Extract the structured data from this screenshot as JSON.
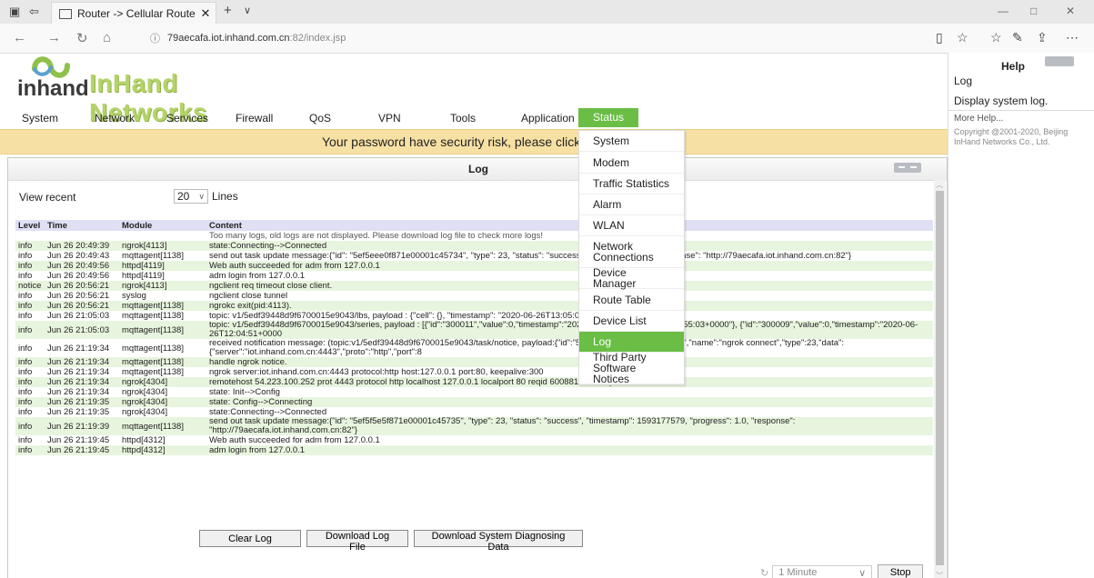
{
  "browser": {
    "tab_title": "Router -> Cellular Route",
    "url_host": "79aecafa.iot.inhand.com.cn",
    "url_path": ":82/index.jsp"
  },
  "logo": {
    "wordmark": "inhand",
    "brand": "InHand Networks"
  },
  "menu": {
    "items": [
      "System",
      "Network",
      "Services",
      "Firewall",
      "QoS",
      "VPN",
      "Tools",
      "Application",
      "Status"
    ],
    "active": "Status"
  },
  "banner": "Your password have security risk, please click here",
  "panel": {
    "title": "Log"
  },
  "view": {
    "label": "View recent",
    "lines_value": "20",
    "lines_label": "Lines"
  },
  "table": {
    "headers": [
      "Level",
      "Time",
      "Module",
      "Content"
    ],
    "notice": "Too many logs, old logs are not displayed. Please download log file to check more logs!",
    "rows": [
      {
        "level": "info",
        "time": "Jun 26 20:49:39",
        "module": "ngrok[4113]",
        "content": "state:Connecting-->Connected"
      },
      {
        "level": "info",
        "time": "Jun 26 20:49:43",
        "module": "mqttagent[1138]",
        "content": "send out task update message:{\"id\": \"5ef5eee0f871e00001c45734\", \"type\": 23, \"status\": \"success\", \"ti                                                         progress\": 1.0, \"response\": \"http://79aecafa.iot.inhand.com.cn:82\"}"
      },
      {
        "level": "info",
        "time": "Jun 26 20:49:56",
        "module": "httpd[4119]",
        "content": "Web auth succeeded for adm from 127.0.0.1"
      },
      {
        "level": "info",
        "time": "Jun 26 20:49:56",
        "module": "httpd[4119]",
        "content": "adm login from 127.0.0.1"
      },
      {
        "level": "notice",
        "time": "Jun 26 20:56:21",
        "module": "ngrok[4113]",
        "content": "ngclient req timeout close client."
      },
      {
        "level": "info",
        "time": "Jun 26 20:56:21",
        "module": "syslog",
        "content": "ngclient close tunnel"
      },
      {
        "level": "info",
        "time": "Jun 26 20:56:21",
        "module": "mqttagent[1138]",
        "content": "ngrokc exit(pid:4113)."
      },
      {
        "level": "info",
        "time": "Jun 26 21:05:03",
        "module": "mqttagent[1138]",
        "content": "topic: v1/5edf39448d9f6700015e9043/lbs, payload : {\"cell\": {}, \"timestamp\": \"2020-06-26T13:05:03+00"
      },
      {
        "level": "info",
        "time": "Jun 26 21:05:03",
        "module": "mqttagent[1138]",
        "content": "topic: v1/5edf39448d9f6700015e9043/series, payload : [{\"id\":\"300011\",\"value\":0,\"timestamp\":\"2020-06                                              me\":\"2020-06-26T12:55:03+0000\"}, {\"id\":\"300009\",\"value\":0,\"timestamp\":\"2020-06-26T12:04:51+0000"
      },
      {
        "level": "info",
        "time": "Jun 26 21:19:34",
        "module": "mqttagent[1138]",
        "content": "received notification message: (topic:v1/5edf39448d9f6700015e9043/task/notice, payload:{\"id\":\"5ef5f5e5f871e00001c45735\",\"name\":\"ngrok connect\",\"type\":23,\"data\": {\"server\":\"iot.inhand.com.cn:4443\",\"proto\":\"http\",\"port\":8"
      },
      {
        "level": "info",
        "time": "Jun 26 21:19:34",
        "module": "mqttagent[1138]",
        "content": "handle ngrok notice."
      },
      {
        "level": "info",
        "time": "Jun 26 21:19:34",
        "module": "mqttagent[1138]",
        "content": "ngrok server:iot.inhand.com.cn:4443 protocol:http host:127.0.0.1 port:80, keepalive:300"
      },
      {
        "level": "info",
        "time": "Jun 26 21:19:34",
        "module": "ngrok[4304]",
        "content": "remotehost 54.223.100.252 prot 4443 protocol http localhost 127.0.0.1 localport 80 reqid 600881523 keepalive 300"
      },
      {
        "level": "info",
        "time": "Jun 26 21:19:34",
        "module": "ngrok[4304]",
        "content": "state: Init-->Config"
      },
      {
        "level": "info",
        "time": "Jun 26 21:19:35",
        "module": "ngrok[4304]",
        "content": "state: Config-->Connecting"
      },
      {
        "level": "info",
        "time": "Jun 26 21:19:35",
        "module": "ngrok[4304]",
        "content": "state:Connecting-->Connected"
      },
      {
        "level": "info",
        "time": "Jun 26 21:19:39",
        "module": "mqttagent[1138]",
        "content": "send out task update message:{\"id\": \"5ef5f5e5f871e00001c45735\", \"type\": 23, \"status\": \"success\", \"timestamp\": 1593177579, \"progress\": 1.0, \"response\": \"http://79aecafa.iot.inhand.com.cn:82\"}"
      },
      {
        "level": "info",
        "time": "Jun 26 21:19:45",
        "module": "httpd[4312]",
        "content": "Web auth succeeded for adm from 127.0.0.1"
      },
      {
        "level": "info",
        "time": "Jun 26 21:19:45",
        "module": "httpd[4312]",
        "content": "adm login from 127.0.0.1"
      }
    ]
  },
  "buttons": {
    "clear": "Clear Log",
    "download": "Download Log File",
    "diag": "Download System Diagnosing Data"
  },
  "refresh": {
    "interval": "1 Minute",
    "stop": "Stop"
  },
  "dropdown": {
    "items": [
      "System",
      "Modem",
      "Traffic Statistics",
      "Alarm",
      "WLAN",
      "Network Connections",
      "Device Manager",
      "Route Table",
      "Device List",
      "Log",
      "Third Party Software Notices"
    ],
    "selected": "Log"
  },
  "help": {
    "title": "Help",
    "subtitle": "Log",
    "description": "Display system log.",
    "more": "More Help...",
    "copyright": "Copyright @2001-2020, Beijing InHand Networks Co., Ltd."
  },
  "colors": {
    "accent": "#6abd45",
    "banner_bg": "#f7e0a3",
    "row_green": "#e8f5de",
    "brand_green": "#b5d36b"
  }
}
